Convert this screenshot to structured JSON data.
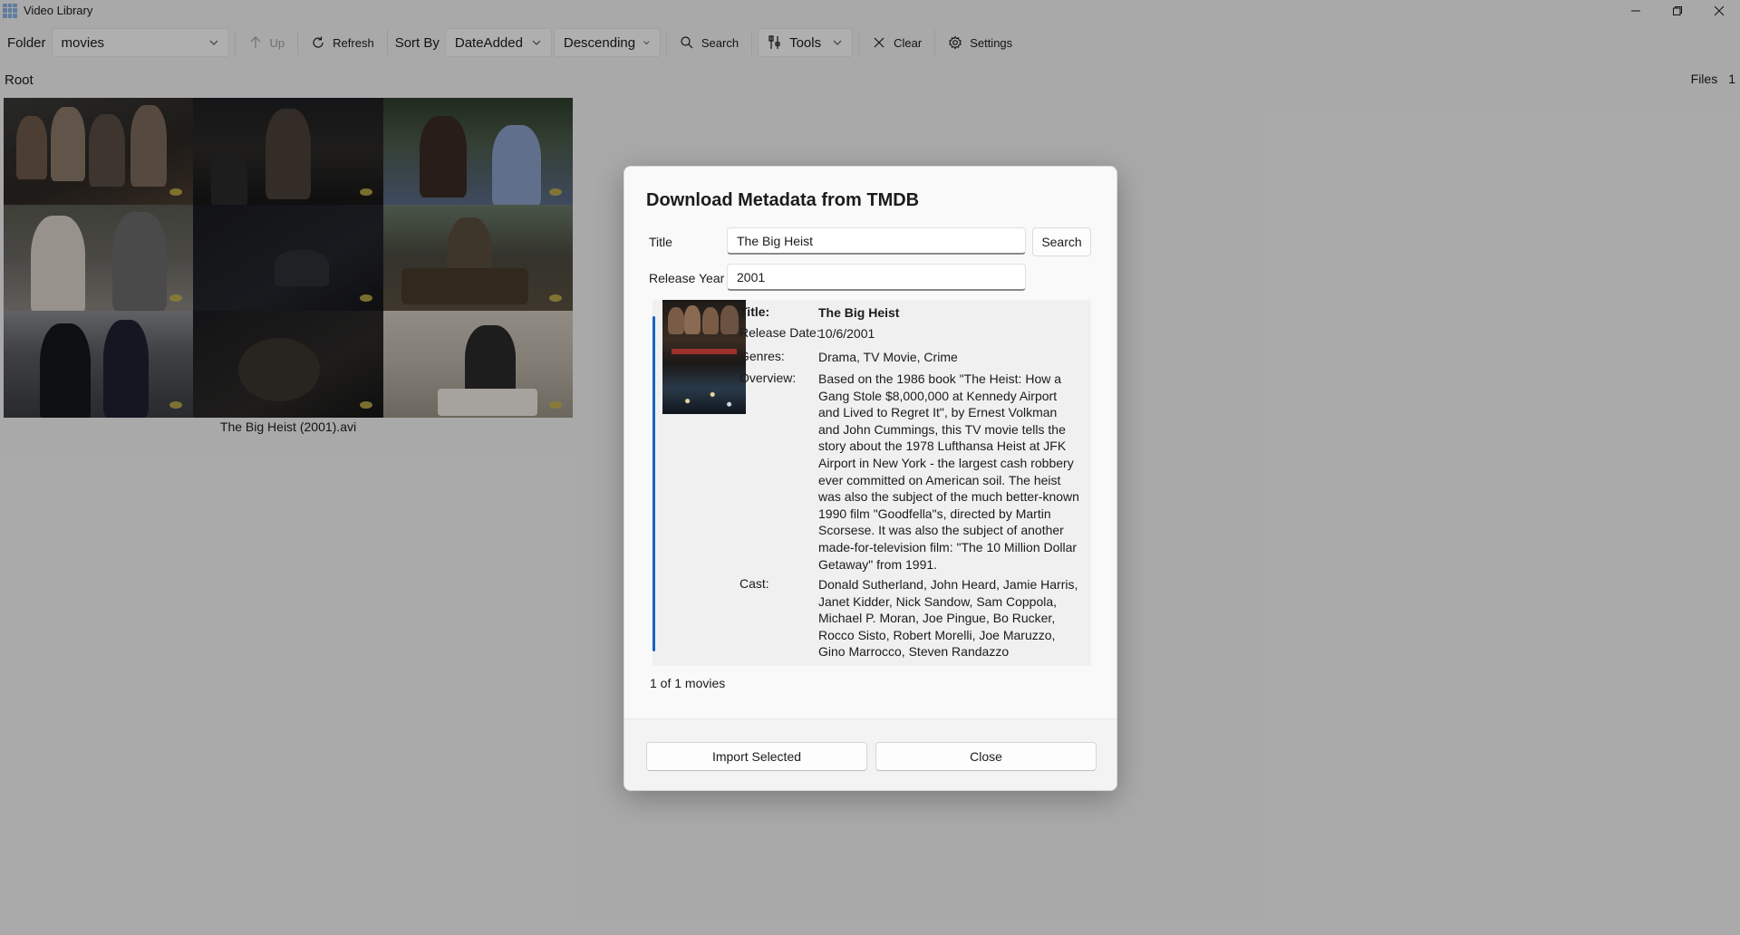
{
  "window": {
    "title": "Video Library",
    "controls": [
      "minimize",
      "restore",
      "close"
    ]
  },
  "toolbar": {
    "folder_label": "Folder",
    "folder_value": "movies",
    "up_label": "Up",
    "refresh_label": "Refresh",
    "sort_label": "Sort By",
    "sort_value": "DateAdded",
    "order_value": "Descending",
    "search_label": "Search",
    "tools_label": "Tools",
    "clear_label": "Clear",
    "settings_label": "Settings"
  },
  "browser": {
    "breadcrumb": "Root",
    "files_label": "Files",
    "files_count": "1",
    "item_caption": "The Big Heist (2001).avi"
  },
  "dialog": {
    "title": "Download Metadata from TMDB",
    "title_label": "Title",
    "title_value": "The Big Heist",
    "search_button": "Search",
    "year_label": "Release Year",
    "year_value": "2001",
    "result": {
      "title_key": "Title:",
      "title": "The Big Heist",
      "release_key": "Release Date:",
      "release_date": "10/6/2001",
      "genres_key": "Genres:",
      "genres": "Drama, TV Movie, Crime",
      "overview_key": "Overview:",
      "overview": "Based on the 1986 book \"The Heist: How a Gang Stole $8,000,000 at Kennedy Airport and Lived to Regret It\", by Ernest Volkman and John Cummings,  this TV movie tells the story about the 1978 Lufthansa Heist at JFK Airport in New York - the largest cash robbery ever committed on American soil. The heist was also the subject of the much better-known 1990 film \"Goodfella\"s, directed by Martin Scorsese. It was also the subject of another made-for-television film: \"The 10 Million Dollar Getaway\" from 1991.",
      "cast_key": "Cast:",
      "cast": "Donald Sutherland, John Heard, Jamie Harris, Janet Kidder, Nick Sandow, Sam Coppola, Michael P. Moran, Joe Pingue, Bo Rucker, Rocco Sisto, Robert Morelli, Joe Maruzzo, Gino Marrocco, Steven Randazzo"
    },
    "count_text": "1 of 1 movies",
    "import_button": "Import Selected",
    "close_button": "Close"
  }
}
